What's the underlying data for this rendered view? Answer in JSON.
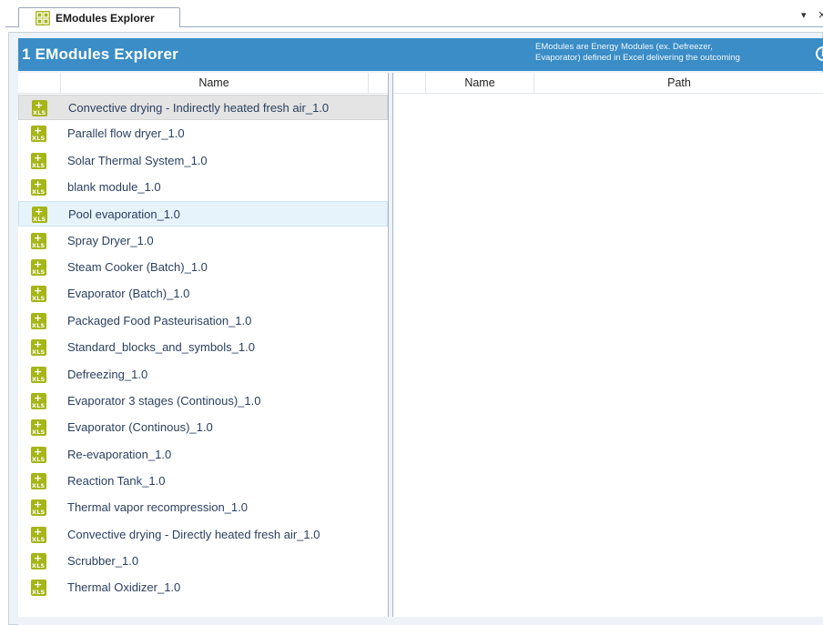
{
  "tab": {
    "title": "EModules Explorer",
    "menu_glyph": "▾",
    "close_glyph": "×"
  },
  "header": {
    "title": "1 EModules Explorer",
    "description_line1": "EModules are Energy Modules (ex. Defreezer,",
    "description_line2": "Evaporator) defined in Excel delivering the outcoming",
    "info_glyph": "i"
  },
  "left_table": {
    "column_name": "Name",
    "rows": [
      {
        "label": "Convective drying - Indirectly heated fresh air_1.0",
        "state": "selected"
      },
      {
        "label": "Parallel flow dryer_1.0",
        "state": ""
      },
      {
        "label": "Solar Thermal System_1.0",
        "state": ""
      },
      {
        "label": "blank module_1.0",
        "state": ""
      },
      {
        "label": "Pool evaporation_1.0",
        "state": "hover"
      },
      {
        "label": "Spray Dryer_1.0",
        "state": ""
      },
      {
        "label": "Steam Cooker (Batch)_1.0",
        "state": ""
      },
      {
        "label": "Evaporator (Batch)_1.0",
        "state": ""
      },
      {
        "label": "Packaged Food Pasteurisation_1.0",
        "state": ""
      },
      {
        "label": "Standard_blocks_and_symbols_1.0",
        "state": ""
      },
      {
        "label": "Defreezing_1.0",
        "state": ""
      },
      {
        "label": "Evaporator 3 stages (Continous)_1.0",
        "state": ""
      },
      {
        "label": "Evaporator (Continous)_1.0",
        "state": ""
      },
      {
        "label": "Re-evaporation_1.0",
        "state": ""
      },
      {
        "label": "Reaction Tank_1.0",
        "state": ""
      },
      {
        "label": "Thermal vapor recompression_1.0",
        "state": ""
      },
      {
        "label": "Convective drying - Directly heated fresh air_1.0",
        "state": ""
      },
      {
        "label": "Scrubber_1.0",
        "state": ""
      },
      {
        "label": "Thermal Oxidizer_1.0",
        "state": ""
      }
    ],
    "row_icon": "excel-module-icon",
    "row_icon_text": "XLS"
  },
  "right_table": {
    "column_name": "Name",
    "column_path": "Path"
  },
  "colors": {
    "header_bg": "#3a8dc6",
    "icon_green": "#a6b517",
    "selected_row": "#e4e4e4",
    "hover_row": "#e6f3fb"
  }
}
